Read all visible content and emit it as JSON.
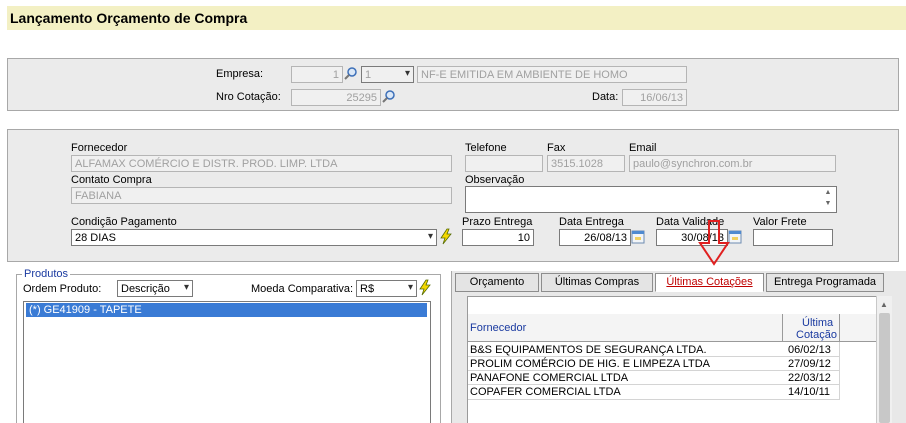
{
  "page": {
    "title": "Lançamento Orçamento de Compra"
  },
  "header": {
    "empresa_label": "Empresa:",
    "empresa_code": "1",
    "empresa_select": "1",
    "empresa_desc": "NF-E EMITIDA EM AMBIENTE DE HOMO",
    "nro_cotacao_label": "Nro Cotação:",
    "nro_cotacao": "25295",
    "data_label": "Data:",
    "data": "16/06/13"
  },
  "supplier": {
    "fornecedor_label": "Fornecedor",
    "fornecedor": "ALFAMAX COMÉRCIO E DISTR. PROD. LIMP. LTDA",
    "telefone_label": "Telefone",
    "telefone": "",
    "fax_label": "Fax",
    "fax": "3515.1028",
    "email_label": "Email",
    "email": "paulo@synchron.com.br",
    "contato_label": "Contato Compra",
    "contato": "FABIANA",
    "observacao_label": "Observação",
    "observacao": "",
    "condicao_label": "Condição Pagamento",
    "condicao": "28 DIAS",
    "prazo_label": "Prazo Entrega",
    "prazo": "10",
    "data_entrega_label": "Data Entrega",
    "data_entrega": "26/08/13",
    "data_validade_label": "Data Validade",
    "data_validade": "30/08/13",
    "valor_frete_label": "Valor Frete",
    "valor_frete": ""
  },
  "products": {
    "legend": "Produtos",
    "ordem_label": "Ordem Produto:",
    "ordem_value": "Descrição",
    "moeda_label": "Moeda Comparativa:",
    "moeda_value": "R$",
    "items": [
      "(*) GE41909 - TAPETE"
    ]
  },
  "tabs": [
    {
      "label": "Orçamento"
    },
    {
      "label": "Últimas Compras"
    },
    {
      "label": "Últimas Cotações"
    },
    {
      "label": "Entrega Programada"
    }
  ],
  "quotes_table": {
    "col_fornecedor": "Fornecedor",
    "col_cotacao_1": "Última",
    "col_cotacao_2": "Cotação",
    "rows": [
      {
        "fornecedor": "B&S EQUIPAMENTOS DE SEGURANÇA LTDA.",
        "data": "06/02/13"
      },
      {
        "fornecedor": "PROLIM COMÉRCIO DE HIG. E LIMPEZA LTDA",
        "data": "27/09/12"
      },
      {
        "fornecedor": "PANAFONE COMERCIAL LTDA",
        "data": "22/03/12"
      },
      {
        "fornecedor": "COPAFER COMERCIAL LTDA",
        "data": "14/10/11"
      }
    ]
  },
  "colors": {
    "accent_red": "#e02020",
    "selected_blue": "#3a7bd5",
    "title_bg": "#f3f0c4",
    "link_blue": "#1a3aa0"
  }
}
